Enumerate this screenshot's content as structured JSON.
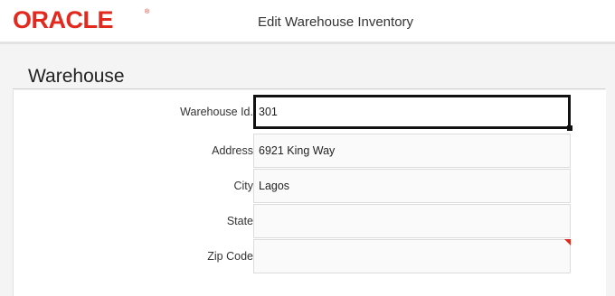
{
  "header": {
    "logo_text": "ORACLE",
    "logo_mark": "®",
    "title": "Edit Warehouse Inventory"
  },
  "section": {
    "title": "Warehouse"
  },
  "form": {
    "rows": [
      {
        "label": "Warehouse Id.",
        "value": "301",
        "selected": true
      },
      {
        "label": "Address",
        "value": "6921 King Way"
      },
      {
        "label": "City",
        "value": "Lagos"
      },
      {
        "label": "State",
        "value": ""
      },
      {
        "label": "Zip Code",
        "value": "",
        "required_marker": true
      }
    ]
  },
  "colors": {
    "brand": "#e3281d",
    "active_border": "#111111"
  }
}
